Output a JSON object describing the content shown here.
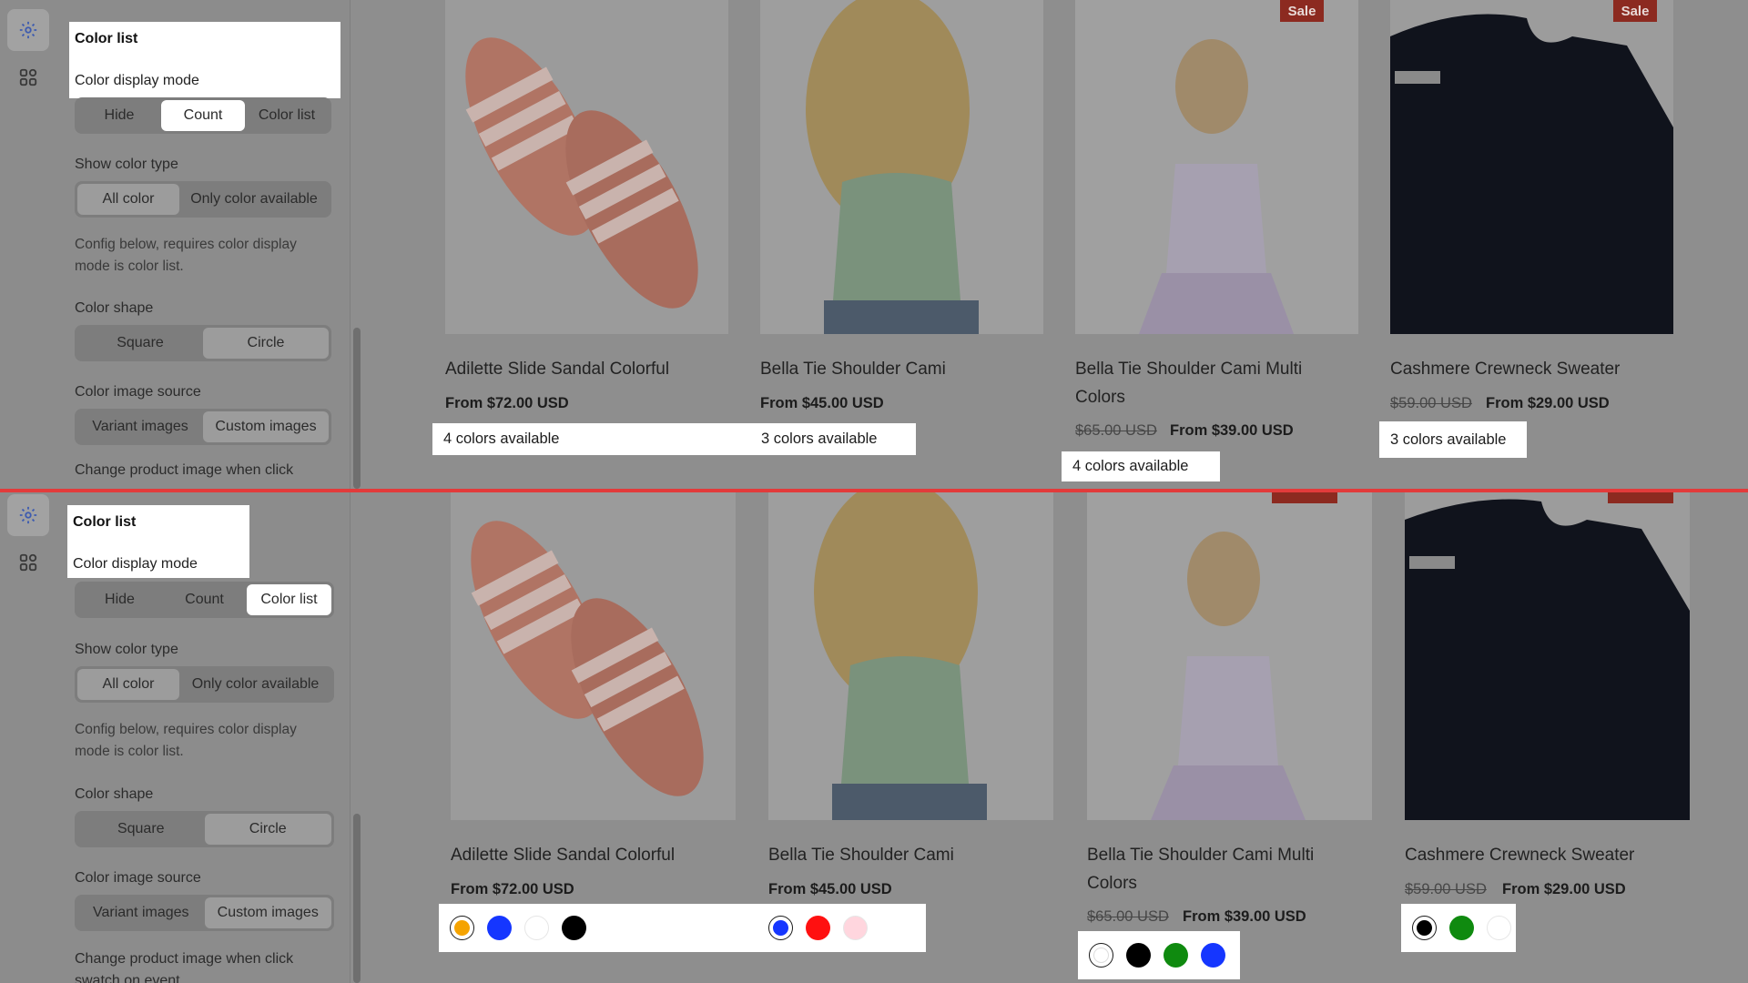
{
  "top": {
    "settings": {
      "highlight_title": "Color list",
      "display_mode_label": "Color display mode",
      "display_mode_options": [
        "Hide",
        "Count",
        "Color list"
      ],
      "display_mode_selected": "Count",
      "show_color_type_label": "Show color type",
      "show_color_type_options": [
        "All color",
        "Only color available"
      ],
      "config_note": "Config below, requires color display mode is color list.",
      "color_shape_label": "Color shape",
      "color_shape_options": [
        "Square",
        "Circle"
      ],
      "image_source_label": "Color image source",
      "image_source_options": [
        "Variant images",
        "Custom images"
      ],
      "change_image_label": "Change product image when click"
    },
    "products": [
      {
        "name": "Adilette Slide Sandal Colorful",
        "price": "From $72.00 USD",
        "availability": "4 colors available"
      },
      {
        "name": "Bella Tie Shoulder Cami",
        "price": "From $45.00 USD",
        "availability": "3 colors available"
      },
      {
        "name": "Bella Tie Shoulder Cami Multi Colors",
        "compare_price": "$65.00 USD",
        "price": "From $39.00 USD",
        "availability": "4 colors available",
        "badge": "Sale"
      },
      {
        "name": "Cashmere Crewneck Sweater",
        "compare_price": "$59.00 USD",
        "price": "From $29.00 USD",
        "availability": "3 colors available",
        "badge": "Sale"
      }
    ]
  },
  "bottom": {
    "settings": {
      "highlight_title": "Color list",
      "display_mode_label": "Color display mode",
      "display_mode_options": [
        "Hide",
        "Count",
        "Color list"
      ],
      "display_mode_selected": "Color list",
      "show_color_type_label": "Show color type",
      "show_color_type_options": [
        "All color",
        "Only color available"
      ],
      "config_note": "Config below, requires color display mode is color list.",
      "color_shape_label": "Color shape",
      "color_shape_options": [
        "Square",
        "Circle"
      ],
      "image_source_label": "Color image source",
      "image_source_options": [
        "Variant images",
        "Custom images"
      ],
      "change_image_label": "Change product image when click swatch on event"
    },
    "products": [
      {
        "name": "Adilette Slide Sandal Colorful",
        "price": "From $72.00 USD",
        "swatches": [
          "#f5a300",
          "#1536ff",
          "#ffffff",
          "#000000"
        ],
        "selected_swatch": 0
      },
      {
        "name": "Bella Tie Shoulder Cami",
        "price": "From $45.00 USD",
        "swatches": [
          "#1536ff",
          "#ff1010",
          "#ffd6de"
        ],
        "selected_swatch": 0
      },
      {
        "name": "Bella Tie Shoulder Cami Multi Colors",
        "compare_price": "$65.00 USD",
        "price": "From $39.00 USD",
        "swatches": [
          "#ffffff",
          "#000000",
          "#0f8a0f",
          "#1536ff"
        ],
        "selected_swatch": 0
      },
      {
        "name": "Cashmere Crewneck Sweater",
        "compare_price": "$59.00 USD",
        "price": "From $29.00 USD",
        "swatches": [
          "#000000",
          "#0f8a0f",
          "#ffffff"
        ],
        "selected_swatch": 0
      }
    ]
  },
  "icons": {
    "settings": "gear-icon",
    "apps": "apps-icon"
  },
  "colors": {
    "divider": "#e23b3b",
    "sale_badge": "#8c2a20",
    "overlay": "#8f8f8f"
  }
}
